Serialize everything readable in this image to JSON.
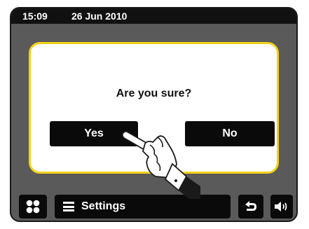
{
  "status_bar": {
    "time": "15:09",
    "date": "26 Jun 2010"
  },
  "dialog": {
    "question": "Are you sure?",
    "yes_label": "Yes",
    "no_label": "No"
  },
  "bottom_bar": {
    "settings_label": "Settings",
    "icons": [
      "home-grid-icon",
      "menu-icon",
      "back-icon",
      "volume-icon"
    ]
  },
  "colors": {
    "dialog_border": "#f2d21a",
    "button_bg": "#0a0a0a",
    "screen_bg": "#5a5a5a"
  }
}
